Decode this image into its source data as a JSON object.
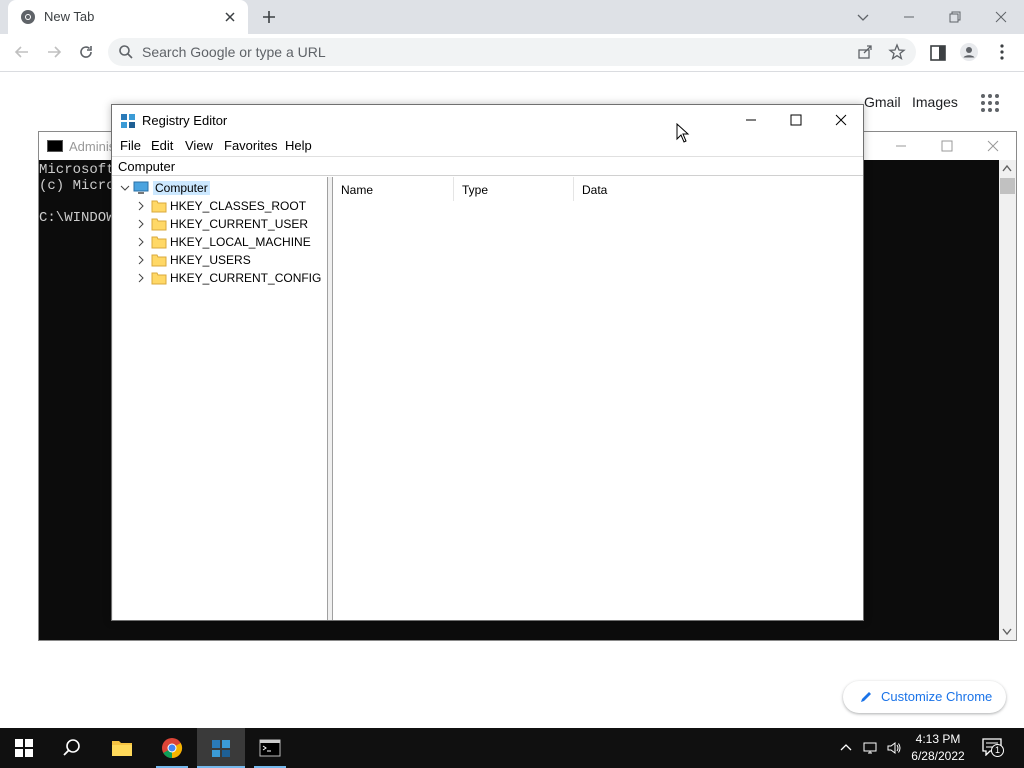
{
  "chrome": {
    "tab_title": "New Tab",
    "omnibox_placeholder": "Search Google or type a URL",
    "ntp_links": [
      "Gmail",
      "Images"
    ],
    "customize_label": "Customize Chrome"
  },
  "cmd": {
    "title": "Adminis",
    "lines": [
      "Microsoft",
      "(c) Micro",
      "",
      "C:\\WINDOW"
    ]
  },
  "regedit": {
    "title": "Registry Editor",
    "menu": [
      "File",
      "Edit",
      "View",
      "Favorites",
      "Help"
    ],
    "address": "Computer",
    "tree_root": "Computer",
    "hives": [
      "HKEY_CLASSES_ROOT",
      "HKEY_CURRENT_USER",
      "HKEY_LOCAL_MACHINE",
      "HKEY_USERS",
      "HKEY_CURRENT_CONFIG"
    ],
    "columns": [
      "Name",
      "Type",
      "Data"
    ]
  },
  "taskbar": {
    "time": "4:13 PM",
    "date": "6/28/2022",
    "notification_count": "1"
  },
  "colors": {
    "accent": "#1a73e8",
    "selection": "#cce8ff",
    "taskbar": "#101010"
  }
}
